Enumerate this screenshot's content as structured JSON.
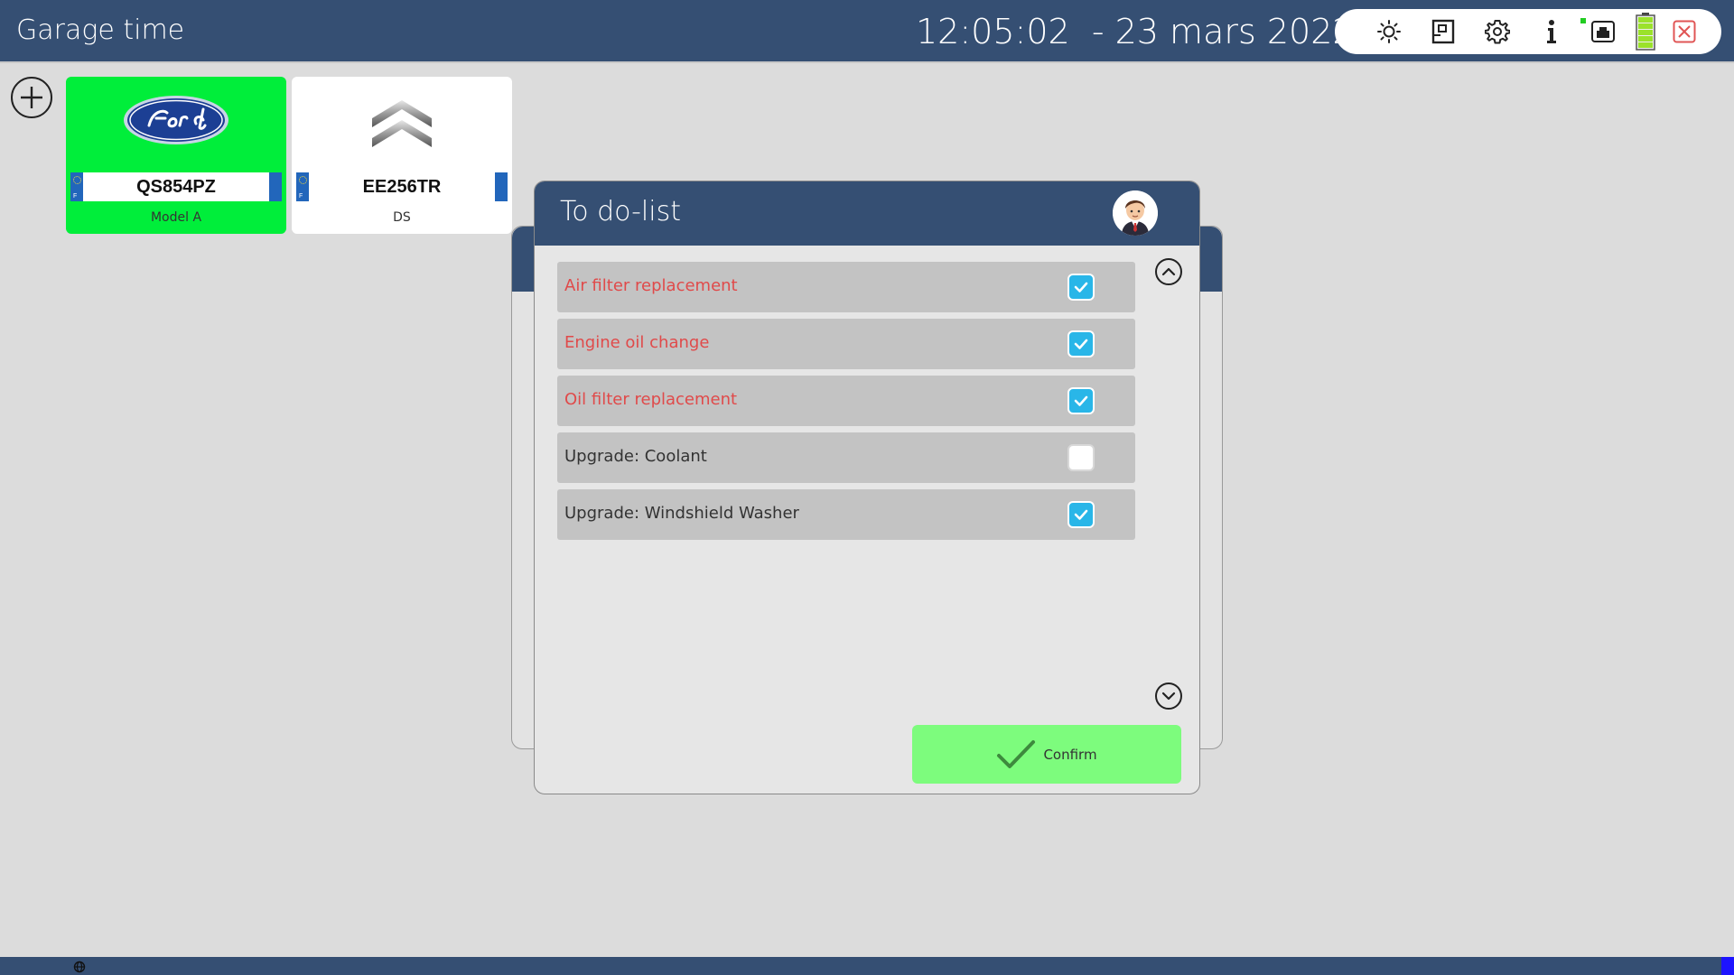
{
  "header": {
    "title": "Garage time",
    "clock": "12:05:02  - 23 mars 2022",
    "icons": [
      "sun-icon",
      "document-icon",
      "gear-icon",
      "info-icon",
      "network-icon",
      "battery-icon",
      "close-icon"
    ]
  },
  "cars": [
    {
      "brand": "Ford",
      "plate": "QS854PZ",
      "model": "Model A",
      "selected": true
    },
    {
      "brand": "Citroen",
      "plate": "EE256TR",
      "model": "DS",
      "selected": false
    }
  ],
  "dialog": {
    "title": "To do-list",
    "items": [
      {
        "label": "Air filter replacement",
        "checked": true
      },
      {
        "label": "Engine oil change",
        "checked": true
      },
      {
        "label": "Oil filter replacement",
        "checked": true
      },
      {
        "label": "Upgrade: Coolant",
        "checked": false
      },
      {
        "label": "Upgrade: Windshield Washer",
        "checked": true
      }
    ],
    "confirm_label": "Confirm"
  },
  "colors": {
    "header_bg": "#354f73",
    "selected_card": "#00ee3a",
    "checkbox_checked": "#29b6e8",
    "done_text": "#e04a4a",
    "confirm_bg": "#7dfc7d"
  }
}
